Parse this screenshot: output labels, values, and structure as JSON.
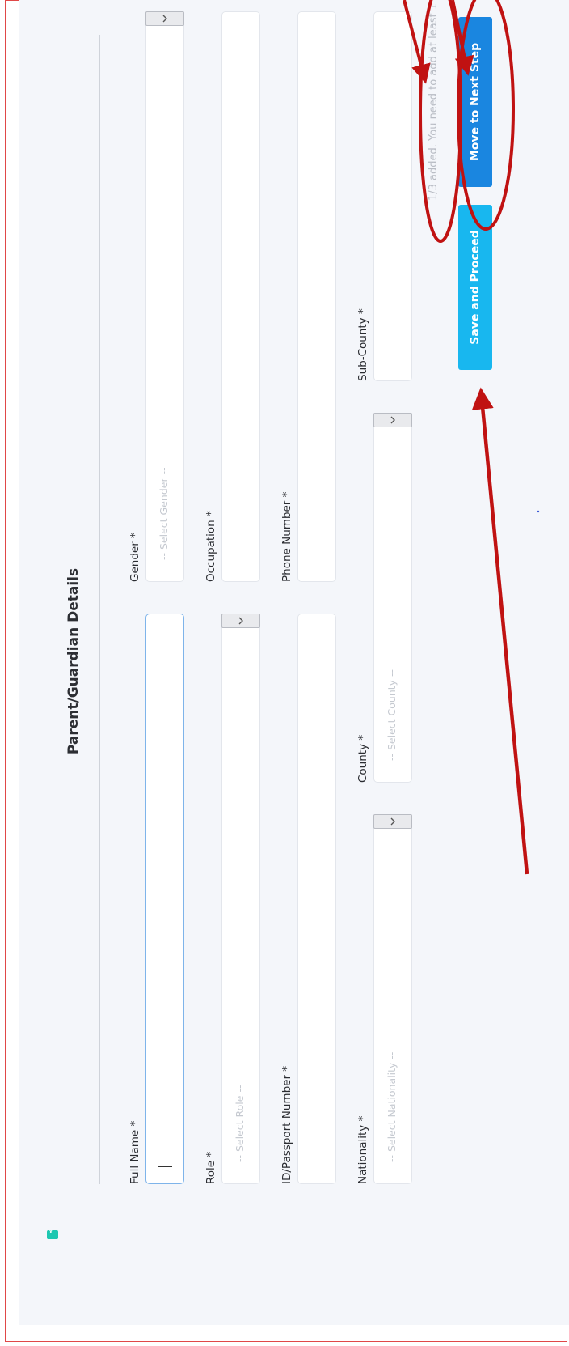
{
  "form": {
    "title": "Parent/Guardian Details",
    "full_name": {
      "label": "Full Name *",
      "value": ""
    },
    "gender": {
      "label": "Gender *",
      "placeholder": "-- Select Gender --"
    },
    "role": {
      "label": "Role *",
      "placeholder": "-- Select Role --"
    },
    "occupation": {
      "label": "Occupation *",
      "value": ""
    },
    "id_passport": {
      "label": "ID/Passport Number *",
      "value": ""
    },
    "phone": {
      "label": "Phone Number *",
      "value": ""
    },
    "nationality": {
      "label": "Nationality *",
      "placeholder": "-- Select Nationality --"
    },
    "county": {
      "label": "County *",
      "placeholder": "-- Select County --"
    },
    "sub_county": {
      "label": "Sub-County *",
      "value": ""
    }
  },
  "actions": {
    "save_label": "Save and Proceed",
    "next_label": "Move to Next Step",
    "status_text": "1/3 added. You need to add at least 1"
  },
  "colors": {
    "save_button": "#18b7ef",
    "next_button": "#1a86e0",
    "annotation": "#c01212",
    "page_background": "#f4f6fa"
  }
}
